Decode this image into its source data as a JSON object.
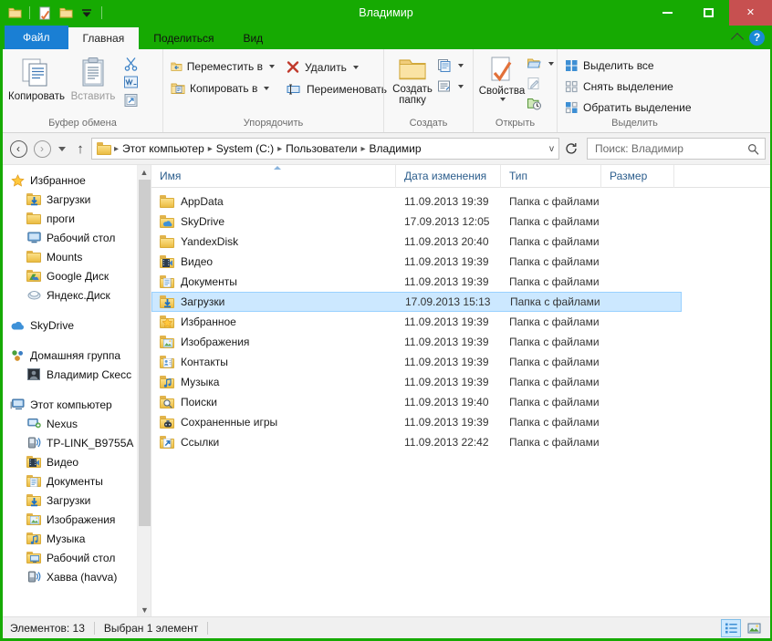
{
  "window": {
    "title": "Владимир",
    "minimize_label": "Свернуть",
    "maximize_label": "Развернуть",
    "close_label": "Закрыть",
    "titlebar_color": "#16aa02",
    "close_color": "#c75050"
  },
  "quick_access": [
    {
      "name": "folder-icon",
      "label": "Свойства папки"
    },
    {
      "name": "properties-icon",
      "label": "Свойства"
    },
    {
      "name": "new-folder-icon",
      "label": "Создать папку"
    },
    {
      "name": "chevron-down-icon",
      "label": "Настройка панели быстрого доступа"
    }
  ],
  "tabs": [
    {
      "id": "file",
      "label": "Файл",
      "state": "file"
    },
    {
      "id": "home",
      "label": "Главная",
      "state": "active"
    },
    {
      "id": "share",
      "label": "Поделиться",
      "state": "inactive"
    },
    {
      "id": "view",
      "label": "Вид",
      "state": "inactive"
    }
  ],
  "tab_right": {
    "collapse_ribbon": "^",
    "help": "?"
  },
  "ribbon": {
    "groups": [
      {
        "title": "Буфер обмена",
        "big": [
          {
            "label": "Копировать",
            "icon": "copy-icon",
            "disabled": false
          },
          {
            "label": "Вставить",
            "icon": "paste-icon",
            "disabled": true
          }
        ],
        "small": [
          {
            "label": "Вырезать",
            "icon": "scissors-icon"
          },
          {
            "label": "Копировать путь",
            "icon": "copy-path-icon"
          },
          {
            "label": "Вставить ярлык",
            "icon": "paste-shortcut-icon"
          }
        ]
      },
      {
        "title": "Упорядочить",
        "items": [
          {
            "label": "Переместить в",
            "icon": "move-to-icon",
            "caret": true
          },
          {
            "label": "Копировать в",
            "icon": "copy-to-icon",
            "caret": true
          },
          {
            "label": "Удалить",
            "icon": "delete-icon",
            "caret": true
          },
          {
            "label": "Переименовать",
            "icon": "rename-icon",
            "caret": false
          }
        ]
      },
      {
        "title": "Создать",
        "big": [
          {
            "label": "Создать папку",
            "icon": "new-folder-icon"
          }
        ],
        "small": [
          {
            "label": "Новый элемент",
            "icon": "new-item-icon",
            "caret": true
          },
          {
            "label": "Простой доступ",
            "icon": "easy-access-icon",
            "caret": true
          }
        ]
      },
      {
        "title": "Открыть",
        "big": [
          {
            "label": "Свойства",
            "icon": "properties-icon",
            "caret": true
          }
        ],
        "small": [
          {
            "label": "Открыть",
            "icon": "open-icon",
            "caret": true
          },
          {
            "label": "Изменить",
            "icon": "edit-icon",
            "caret": false
          },
          {
            "label": "Журнал",
            "icon": "history-icon",
            "caret": false
          }
        ]
      },
      {
        "title": "Выделить",
        "items": [
          {
            "label": "Выделить все",
            "icon": "select-all-icon"
          },
          {
            "label": "Снять выделение",
            "icon": "select-none-icon"
          },
          {
            "label": "Обратить выделение",
            "icon": "invert-selection-icon"
          }
        ]
      }
    ]
  },
  "addressbar": {
    "back_label": "Назад",
    "forward_label": "Вперед",
    "recent_label": "Последние расположения",
    "up_label": "Вверх",
    "crumbs": [
      "Этот компьютер",
      "System (C:)",
      "Пользователи",
      "Владимир"
    ],
    "dropdown": "v",
    "refresh": "Обновить",
    "search_placeholder": "Поиск: Владимир"
  },
  "navpane": {
    "groups": [
      {
        "header": {
          "label": "Избранное",
          "icon": "star-icon"
        },
        "children": [
          {
            "label": "Загрузки",
            "icon": "downloads-folder-icon"
          },
          {
            "label": "проги",
            "icon": "folder-icon"
          },
          {
            "label": "Рабочий стол",
            "icon": "desktop-icon"
          },
          {
            "label": "Mounts",
            "icon": "folder-icon"
          },
          {
            "label": "Google Диск",
            "icon": "google-drive-folder-icon"
          },
          {
            "label": "Яндекс.Диск",
            "icon": "yandex-disk-icon"
          }
        ]
      },
      {
        "header": {
          "label": "SkyDrive",
          "icon": "skydrive-icon"
        },
        "children": []
      },
      {
        "header": {
          "label": "Домашняя группа",
          "icon": "homegroup-icon"
        },
        "children": [
          {
            "label": "Владимир Скесс",
            "icon": "user-icon"
          }
        ]
      },
      {
        "header": {
          "label": "Этот компьютер",
          "icon": "computer-icon"
        },
        "children": [
          {
            "label": "Nexus",
            "icon": "device-icon"
          },
          {
            "label": "TP-LINK_B9755A",
            "icon": "media-device-icon"
          },
          {
            "label": "Видео",
            "icon": "video-folder-icon"
          },
          {
            "label": "Документы",
            "icon": "documents-folder-icon"
          },
          {
            "label": "Загрузки",
            "icon": "downloads-folder-icon"
          },
          {
            "label": "Изображения",
            "icon": "pictures-folder-icon"
          },
          {
            "label": "Музыка",
            "icon": "music-folder-icon"
          },
          {
            "label": "Рабочий стол",
            "icon": "desktop-folder-icon"
          },
          {
            "label": "Хавва (havva)",
            "icon": "media-device-icon"
          }
        ]
      }
    ]
  },
  "filelist": {
    "columns": [
      {
        "key": "name",
        "label": "Имя",
        "sorted": true
      },
      {
        "key": "date",
        "label": "Дата изменения",
        "sorted": false
      },
      {
        "key": "type",
        "label": "Тип",
        "sorted": false
      },
      {
        "key": "size",
        "label": "Размер",
        "sorted": false
      }
    ],
    "rows": [
      {
        "name": "AppData",
        "date": "11.09.2013 19:39",
        "type": "Папка с файлами",
        "size": "",
        "icon": "folder-icon",
        "selected": false
      },
      {
        "name": "SkyDrive",
        "date": "17.09.2013 12:05",
        "type": "Папка с файлами",
        "size": "",
        "icon": "skydrive-folder-icon",
        "selected": false
      },
      {
        "name": "YandexDisk",
        "date": "11.09.2013 20:40",
        "type": "Папка с файлами",
        "size": "",
        "icon": "folder-icon",
        "selected": false
      },
      {
        "name": "Видео",
        "date": "11.09.2013 19:39",
        "type": "Папка с файлами",
        "size": "",
        "icon": "video-folder-icon",
        "selected": false
      },
      {
        "name": "Документы",
        "date": "11.09.2013 19:39",
        "type": "Папка с файлами",
        "size": "",
        "icon": "documents-folder-icon",
        "selected": false
      },
      {
        "name": "Загрузки",
        "date": "17.09.2013 15:13",
        "type": "Папка с файлами",
        "size": "",
        "icon": "downloads-folder-icon",
        "selected": true
      },
      {
        "name": "Избранное",
        "date": "11.09.2013 19:39",
        "type": "Папка с файлами",
        "size": "",
        "icon": "favorites-folder-icon",
        "selected": false
      },
      {
        "name": "Изображения",
        "date": "11.09.2013 19:39",
        "type": "Папка с файлами",
        "size": "",
        "icon": "pictures-folder-icon",
        "selected": false
      },
      {
        "name": "Контакты",
        "date": "11.09.2013 19:39",
        "type": "Папка с файлами",
        "size": "",
        "icon": "contacts-folder-icon",
        "selected": false
      },
      {
        "name": "Музыка",
        "date": "11.09.2013 19:39",
        "type": "Папка с файлами",
        "size": "",
        "icon": "music-folder-icon",
        "selected": false
      },
      {
        "name": "Поиски",
        "date": "11.09.2013 19:40",
        "type": "Папка с файлами",
        "size": "",
        "icon": "searches-folder-icon",
        "selected": false
      },
      {
        "name": "Сохраненные игры",
        "date": "11.09.2013 19:39",
        "type": "Папка с файлами",
        "size": "",
        "icon": "saved-games-folder-icon",
        "selected": false
      },
      {
        "name": "Ссылки",
        "date": "11.09.2013 22:42",
        "type": "Папка с файлами",
        "size": "",
        "icon": "links-folder-icon",
        "selected": false
      }
    ]
  },
  "statusbar": {
    "count": "Элементов: 13",
    "selection": "Выбран 1 элемент",
    "view_details": "Таблица",
    "view_tiles": "Крупные значки"
  }
}
